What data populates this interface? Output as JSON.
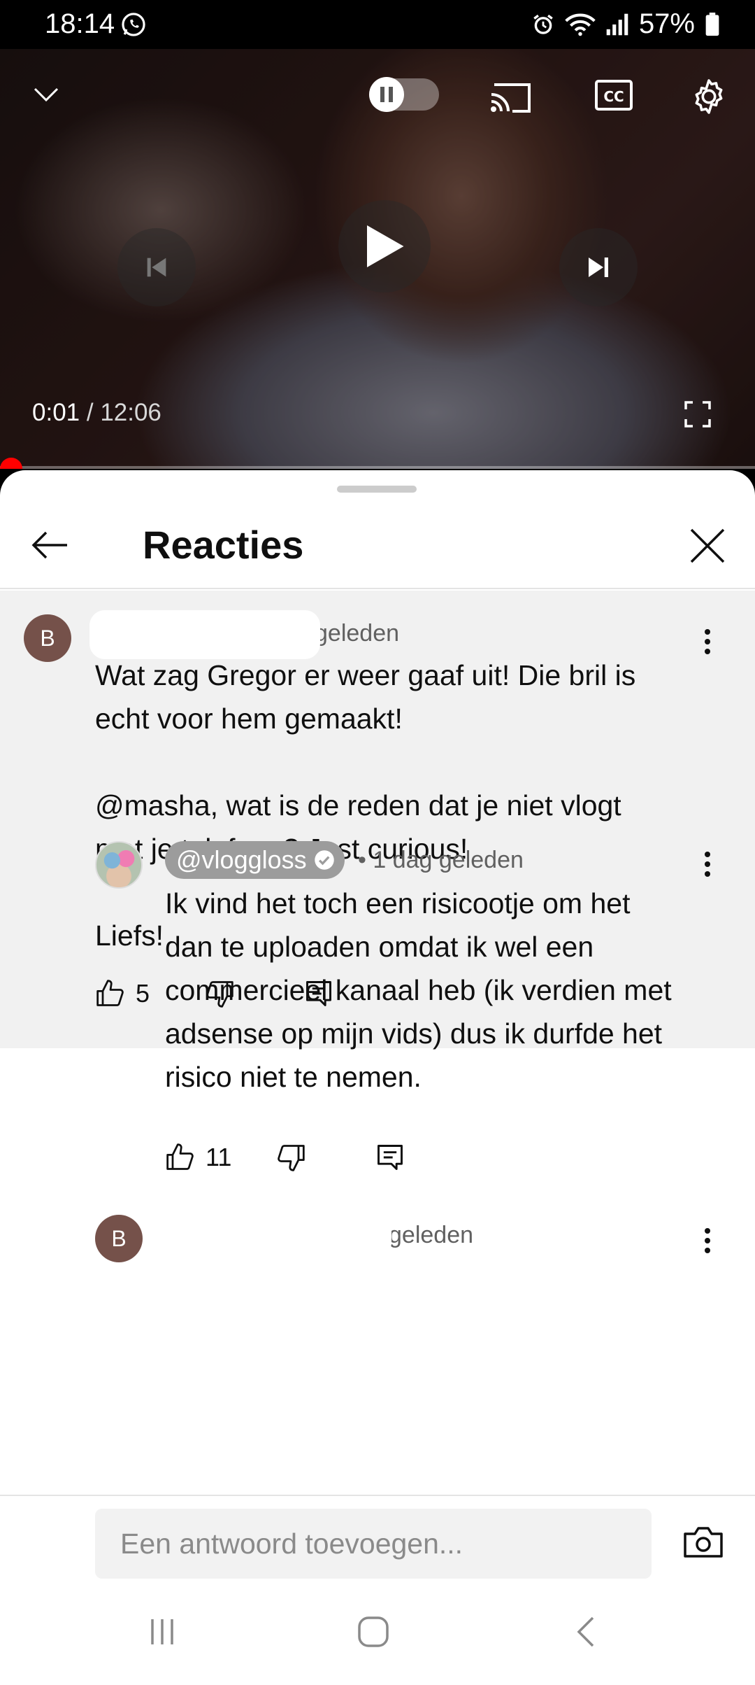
{
  "status_bar": {
    "time": "18:14",
    "battery": "57%"
  },
  "player": {
    "current_time": "0:01",
    "separator": " / ",
    "duration": "12:06",
    "progress": 0.001
  },
  "comments_panel": {
    "title": "Reacties",
    "main_comment": {
      "avatar_letter": "B",
      "time_fragment": "geleden",
      "text": "Wat zag Gregor er weer gaaf uit! Die bril is\necht voor hem gemaakt!\n\n@masha, wat is de reden dat je niet vlogt\nmet je telefoon? Just curious!\n\nLiefs!",
      "likes": "5"
    },
    "reply": {
      "author": "@vloggloss",
      "time": "• 1 dag geleden",
      "text": "Ik vind het toch een risicootje om het\ndan te uploaden omdat ik wel een\ncommercieel kanaal heb (ik verdien met\nadsense op mijn vids) dus ik durfde het\nrisico niet te nemen.",
      "likes": "11"
    },
    "next_comment": {
      "avatar_letter": "B",
      "time_fragment": "geleden"
    },
    "reply_placeholder": "Een antwoord toevoegen..."
  },
  "colors": {
    "progress": "#ff0000",
    "avatar": "#75514a",
    "chip": "#9c9c9c"
  }
}
